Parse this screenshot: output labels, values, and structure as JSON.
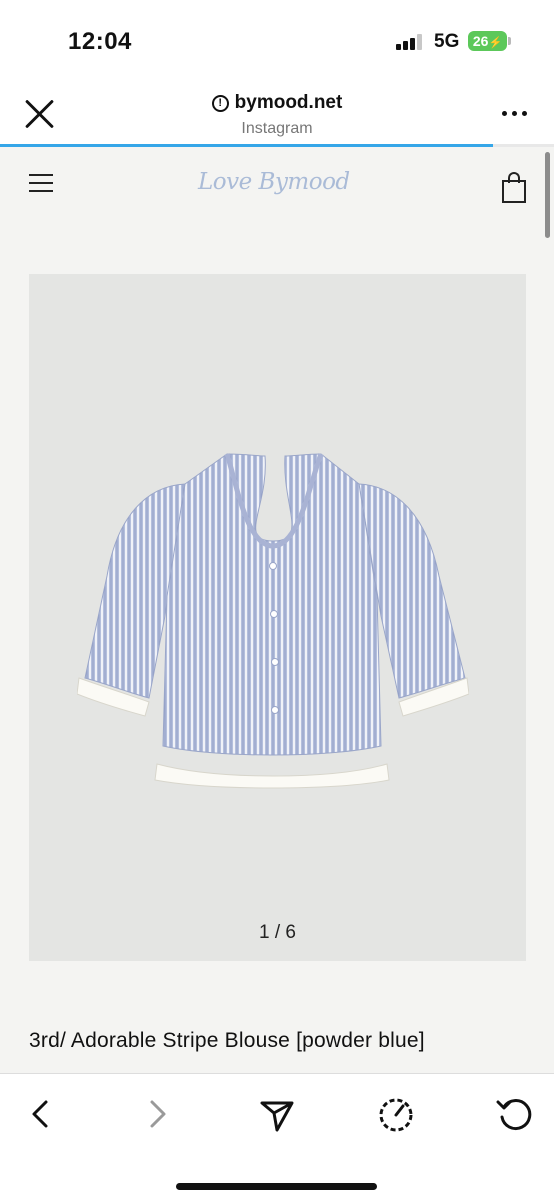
{
  "status_bar": {
    "time": "12:04",
    "network": "5G",
    "battery": "26"
  },
  "browser": {
    "url": "bymood.net",
    "source": "Instagram",
    "close_icon": "close-icon",
    "more_icon": "more-dots-icon",
    "load_progress": 0.89,
    "accent_color": "#35a6e8"
  },
  "site": {
    "logo": "Love Bymood",
    "menu_icon": "hamburger-menu-icon",
    "cart_icon": "shopping-bag-icon"
  },
  "product": {
    "image_counter": "1 / 6",
    "title": "3rd/ Adorable Stripe Blouse [powder blue]",
    "image": "striped-blouse-image"
  },
  "bottom_nav": {
    "icons": [
      "back-icon",
      "forward-icon",
      "share-icon",
      "speed-icon",
      "reload-icon"
    ]
  }
}
